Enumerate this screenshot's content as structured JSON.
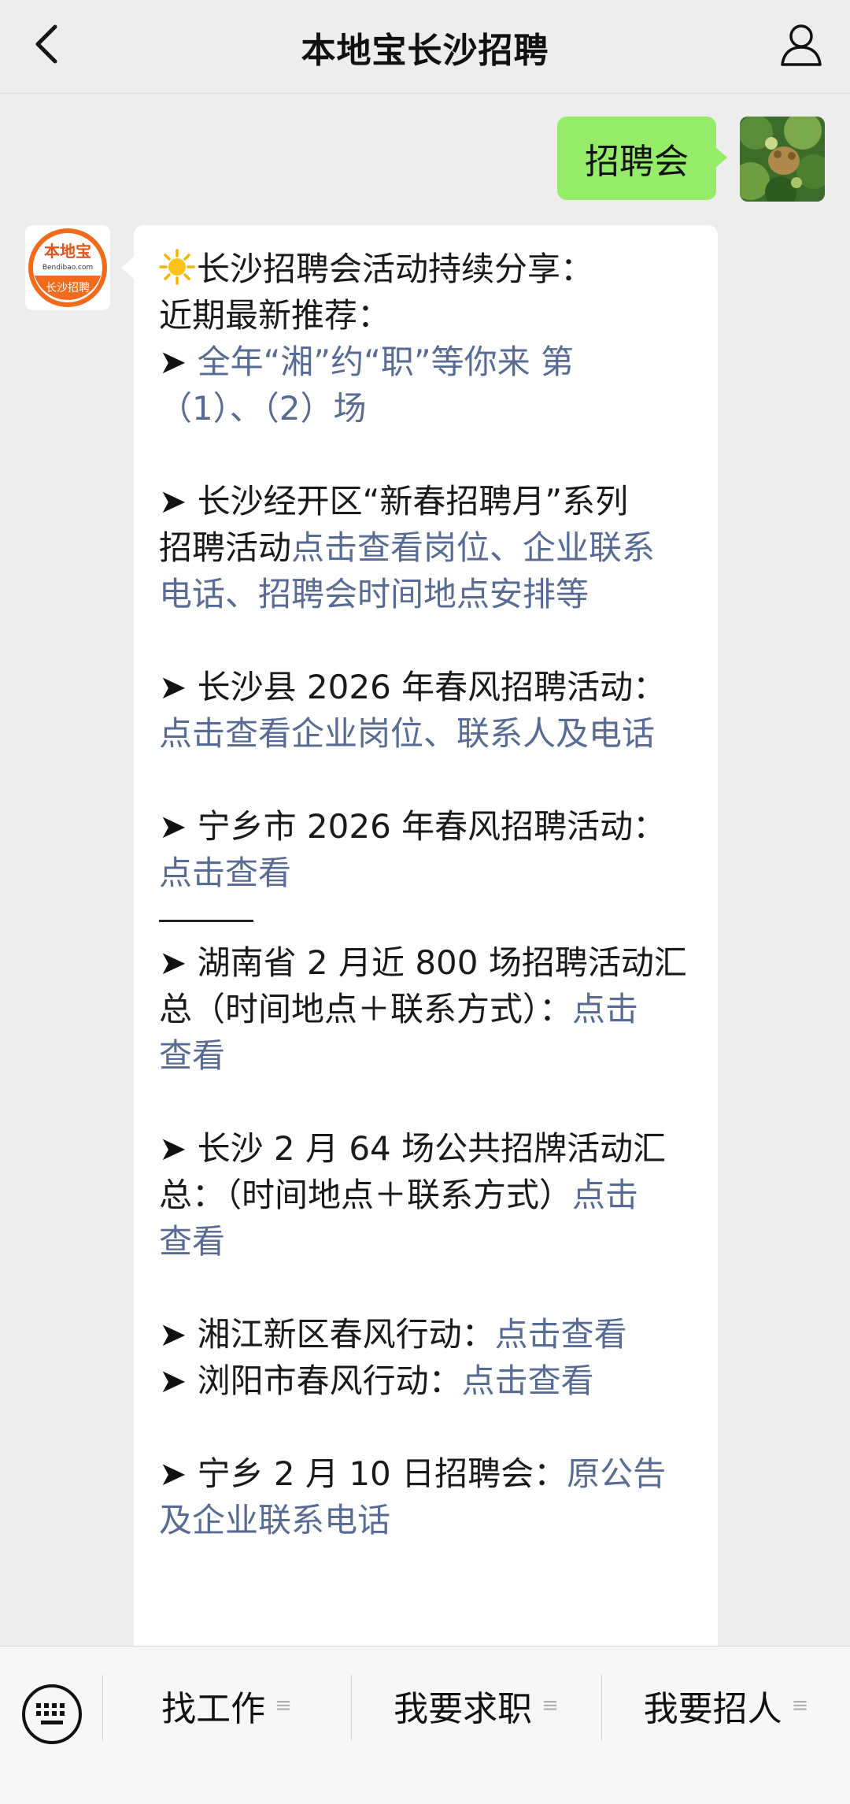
{
  "header": {
    "title": "本地宝长沙招聘"
  },
  "outgoing": {
    "text": "招聘会"
  },
  "bot_avatar": {
    "brand_top": "本地宝",
    "brand_url": "Bendibao.com",
    "brand_bottom": "长沙招聘"
  },
  "message": {
    "title": "长沙招聘会活动持续分享：",
    "subtitle": "近期最新推荐：",
    "arrow": "➤",
    "item1_link_a": "全年“湘”约“职”等你来 第",
    "item1_link_b": "（1）、（2）场",
    "item2_text_a": "长沙经开区“新春招聘月”系列",
    "item2_text_b": "招聘活动",
    "item2_link_b": "点击查看岗位、企业联系",
    "item2_link_c": "电话、招聘会时间地点安排等",
    "item3_text": "长沙县 2026 年春风招聘活动：",
    "item3_link": "点击查看企业岗位、联系人及电话",
    "item4_text": "宁乡市 2026 年春风招聘活动：",
    "item4_link": "点击查看",
    "item5_text_a": "湖南省 2 月近 800 场招聘活动汇",
    "item5_text_b": "总（时间地点＋联系方式）：",
    "item5_link_b": "点击",
    "item5_link_c": "查看",
    "item6_text_a": "长沙 2 月 64 场公共招牌活动汇",
    "item6_text_b": "总：（时间地点＋联系方式）",
    "item6_link_b": "点击",
    "item6_link_c": "查看",
    "item7_text": "湘江新区春风行动：",
    "item7_link": "点击查看",
    "item8_text": "浏阳市春风行动：",
    "item8_link": "点击查看",
    "item9_text": "宁乡 2 月 10 日招聘会：",
    "item9_link_a": "原公告",
    "item9_link_b": "及企业联系电话"
  },
  "menu": {
    "item1": "找工作",
    "item2": "我要求职",
    "item3": "我要招人",
    "lines_glyph": "≡"
  },
  "colors": {
    "link": "#576b95",
    "outgoing_bubble": "#95ec69",
    "brand_orange": "#f26b1d"
  }
}
